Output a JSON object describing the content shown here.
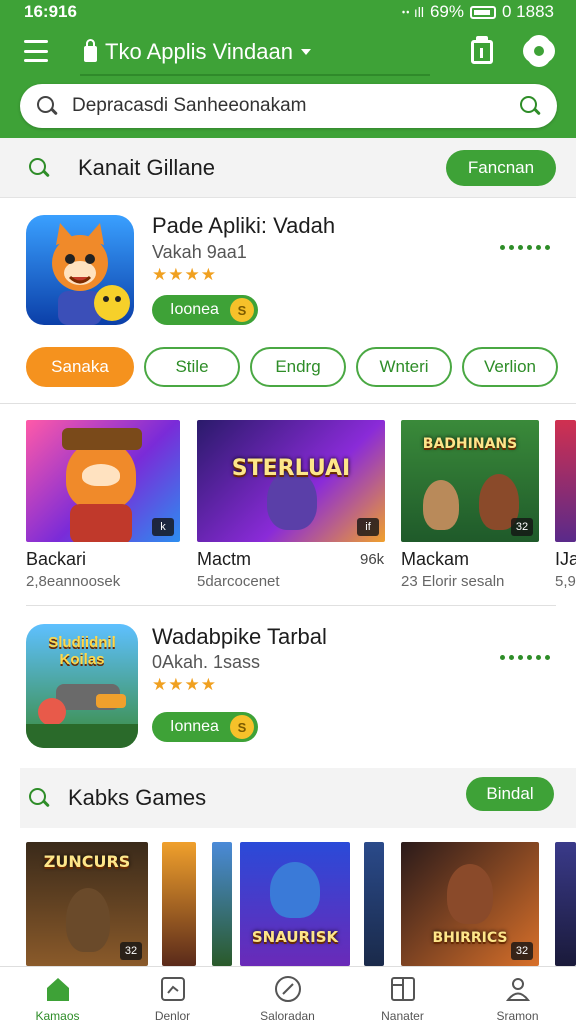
{
  "status_bar": {
    "time": "16:916",
    "indicators": "ꞏꞏ ıll",
    "battery": "69%",
    "right_time": "0 1883"
  },
  "header": {
    "title": "Tko Applis Vindaan"
  },
  "search": {
    "value": "Depracasdi Sanheeonakam"
  },
  "section_1": {
    "title": "Kanait Gillane",
    "button": "Fancnan"
  },
  "featured_1": {
    "name": "Pade Apliki: Vadah",
    "subtitle": "Vakah  9aa1",
    "rating": "★★★★",
    "install_label": "Ioonea",
    "coin": "S"
  },
  "chips": [
    {
      "label": "Sanaka",
      "active": true
    },
    {
      "label": "Stile",
      "active": false
    },
    {
      "label": "Endrg",
      "active": false
    },
    {
      "label": "Wnteri",
      "active": false
    },
    {
      "label": "Verlion",
      "active": false
    }
  ],
  "tiles_1": [
    {
      "name": "Backari",
      "meta": "2,8eannoosek",
      "art_title": "",
      "badge": "k",
      "price": ""
    },
    {
      "name": "Mactm",
      "meta": "5darcocenet",
      "art_title": "STERLUAI",
      "badge": "if",
      "price": "96k"
    },
    {
      "name": "Mackam",
      "meta": "23 Elorir sesaln",
      "art_title": "BADHINANS",
      "badge": "32",
      "price": ""
    },
    {
      "name": "IJa",
      "meta": "5,9",
      "art_title": "",
      "badge": "",
      "price": ""
    }
  ],
  "featured_2": {
    "name": "Wadabpike Tarbal",
    "subtitle": "0Akah. 1sass",
    "rating": "★★★★",
    "install_label": "Ionnea",
    "coin": "S",
    "art_title": "Sludiidnil Koilas"
  },
  "section_2": {
    "title": "Kabks Games",
    "button": "Bindal"
  },
  "tiles_2": [
    {
      "art_title": "ZUNCURS",
      "badge": "32"
    },
    {
      "art_title": "",
      "badge": ""
    },
    {
      "art_title": "",
      "badge": ""
    },
    {
      "art_title": "SNAURISK",
      "badge": ""
    },
    {
      "art_title": "",
      "badge": ""
    },
    {
      "art_title": "BHIRRICS",
      "badge": "32"
    }
  ],
  "bottom_nav": [
    {
      "label": "Kamaos",
      "icon": "home-icon",
      "active": true
    },
    {
      "label": "Denlor",
      "icon": "gamepad-icon",
      "active": false
    },
    {
      "label": "Saloradan",
      "icon": "compass-icon",
      "active": false
    },
    {
      "label": "Nanater",
      "icon": "book-icon",
      "active": false
    },
    {
      "label": "Sramon",
      "icon": "profile-icon",
      "active": false
    }
  ],
  "colors": {
    "brand_green": "#3ea237",
    "accent_orange": "#f5921e",
    "star": "#f0a020"
  }
}
